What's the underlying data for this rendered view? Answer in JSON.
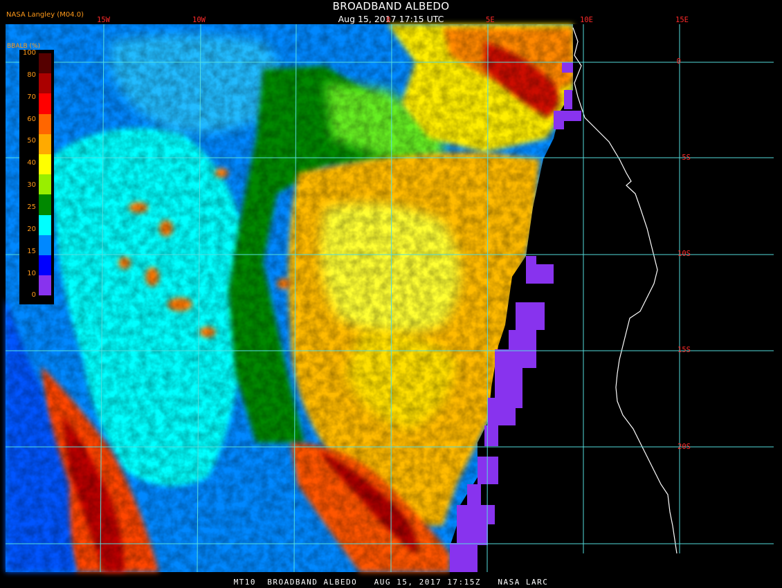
{
  "header": {
    "title": "BROADBAND ALBEDO",
    "subtitle": "Aug 15, 2017 17:15 UTC",
    "source": "NASA Langley (M04.0)"
  },
  "footer": "MT10  BROADBAND ALBEDO   AUG 15, 2017 17:15Z   NASA LARC",
  "legend": {
    "title": "BBALB (%)",
    "ticks": [
      "100",
      "80",
      "70",
      "60",
      "50",
      "40",
      "30",
      "25",
      "20",
      "15",
      "10",
      "0"
    ],
    "colors": [
      "#550000",
      "#aa0000",
      "#ff0000",
      "#ff6600",
      "#ffaa00",
      "#ffff00",
      "#99ee00",
      "#008800",
      "#00ffff",
      "#0088ff",
      "#0000ff",
      "#8833ee"
    ]
  },
  "longitudes": [
    "15W",
    "10W",
    "0",
    "5E",
    "10E",
    "15E"
  ],
  "latitudes": [
    "0",
    "5S",
    "10S",
    "15S",
    "20S"
  ],
  "colors": {
    "grid": "#55dddd",
    "coast": "#ffffff",
    "label_red": "#ff2a2a",
    "label_orange": "#ff9a1a",
    "space_fill": "#8833ee"
  }
}
